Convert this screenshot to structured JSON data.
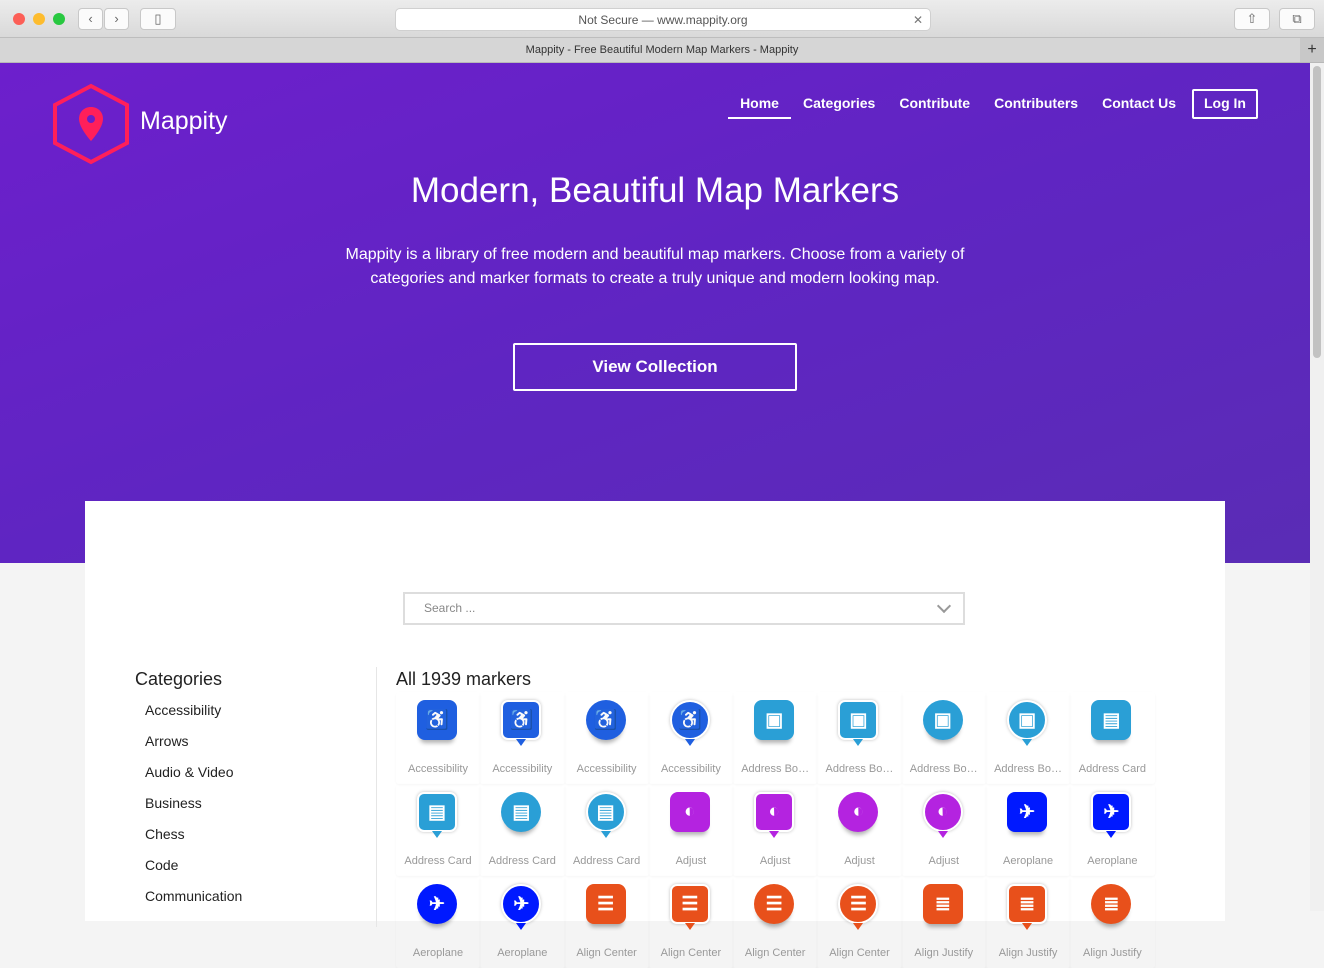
{
  "browser": {
    "url": "Not Secure — www.mappity.org",
    "tab_title": "Mappity - Free Beautiful Modern Map Markers - Mappity"
  },
  "brand": "Mappity",
  "nav": [
    "Home",
    "Categories",
    "Contribute",
    "Contributers",
    "Contact Us",
    "Log In"
  ],
  "hero": {
    "title": "Modern, Beautiful Map Markers",
    "description": "Mappity is a library of free modern and beautiful map markers. Choose from a variety of categories and marker formats to create a truly unique and modern looking map.",
    "cta": "View Collection"
  },
  "search": {
    "placeholder": "Search ..."
  },
  "categories": {
    "title": "Categories",
    "items": [
      "Accessibility",
      "Arrows",
      "Audio & Video",
      "Business",
      "Chess",
      "Code",
      "Communication"
    ]
  },
  "markers_title": "All 1939 markers",
  "colors": {
    "accessibility": "#1f5fe0",
    "address": "#2a9fd6",
    "adjust": "#b423e0",
    "aeroplane": "#0019ff",
    "orange": "#e8501b"
  },
  "markers": [
    {
      "label": "Accessibility",
      "shape": "sq",
      "color": "#1f5fe0",
      "icon": "♿"
    },
    {
      "label": "Accessibility",
      "shape": "sqp",
      "color": "#1f5fe0",
      "icon": "♿"
    },
    {
      "label": "Accessibility",
      "shape": "ci",
      "color": "#1f5fe0",
      "icon": "♿"
    },
    {
      "label": "Accessibility",
      "shape": "cip",
      "color": "#1f5fe0",
      "icon": "♿"
    },
    {
      "label": "Address Book",
      "shape": "sq",
      "color": "#2a9fd6",
      "icon": "▣"
    },
    {
      "label": "Address Book",
      "shape": "sqp",
      "color": "#2a9fd6",
      "icon": "▣"
    },
    {
      "label": "Address Book",
      "shape": "ci",
      "color": "#2a9fd6",
      "icon": "▣"
    },
    {
      "label": "Address Book",
      "shape": "cip",
      "color": "#2a9fd6",
      "icon": "▣"
    },
    {
      "label": "Address Card",
      "shape": "sq",
      "color": "#2a9fd6",
      "icon": "▤"
    },
    {
      "label": "Address Card",
      "shape": "sqp",
      "color": "#2a9fd6",
      "icon": "▤"
    },
    {
      "label": "Address Card",
      "shape": "ci",
      "color": "#2a9fd6",
      "icon": "▤"
    },
    {
      "label": "Address Card",
      "shape": "cip",
      "color": "#2a9fd6",
      "icon": "▤"
    },
    {
      "label": "Adjust",
      "shape": "sq",
      "color": "#b423e0",
      "icon": "◐"
    },
    {
      "label": "Adjust",
      "shape": "sqp",
      "color": "#b423e0",
      "icon": "◐"
    },
    {
      "label": "Adjust",
      "shape": "ci",
      "color": "#b423e0",
      "icon": "◐"
    },
    {
      "label": "Adjust",
      "shape": "cip",
      "color": "#b423e0",
      "icon": "◐"
    },
    {
      "label": "Aeroplane",
      "shape": "sq",
      "color": "#0019ff",
      "icon": "✈"
    },
    {
      "label": "Aeroplane",
      "shape": "sqp",
      "color": "#0019ff",
      "icon": "✈"
    },
    {
      "label": "Aeroplane",
      "shape": "ci",
      "color": "#0019ff",
      "icon": "✈"
    },
    {
      "label": "Aeroplane",
      "shape": "cip",
      "color": "#0019ff",
      "icon": "✈"
    },
    {
      "label": "Align Center",
      "shape": "sq",
      "color": "#e8501b",
      "icon": "☰"
    },
    {
      "label": "Align Center",
      "shape": "sqp",
      "color": "#e8501b",
      "icon": "☰"
    },
    {
      "label": "Align Center",
      "shape": "ci",
      "color": "#e8501b",
      "icon": "☰"
    },
    {
      "label": "Align Center",
      "shape": "cip",
      "color": "#e8501b",
      "icon": "☰"
    },
    {
      "label": "Align Justify",
      "shape": "sq",
      "color": "#e8501b",
      "icon": "≣"
    },
    {
      "label": "Align Justify",
      "shape": "sqp",
      "color": "#e8501b",
      "icon": "≣"
    },
    {
      "label": "Align Justify",
      "shape": "ci",
      "color": "#e8501b",
      "icon": "≣"
    }
  ]
}
